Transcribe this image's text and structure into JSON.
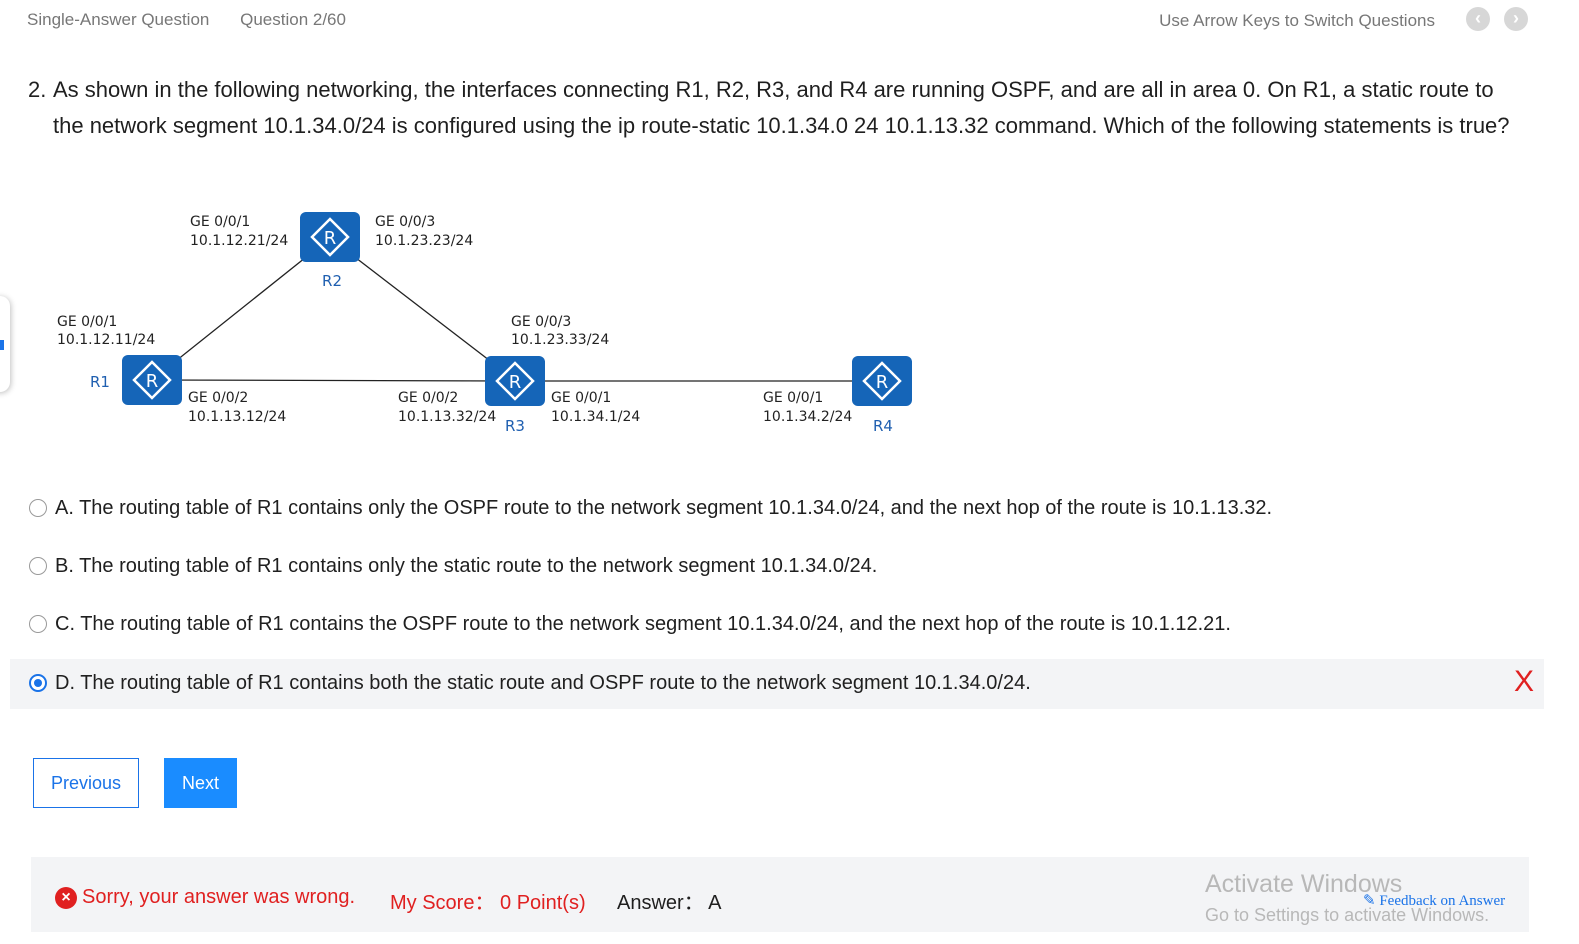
{
  "topbar": {
    "question_type": "Single-Answer Question",
    "question_counter": "Question 2/60",
    "hint": "Use Arrow Keys to Switch Questions",
    "prev_icon": "chevron-left-icon",
    "next_icon": "chevron-right-icon"
  },
  "question": {
    "number": "2.",
    "text": "As shown in the following networking, the interfaces connecting R1, R2, R3, and R4 are running OSPF, and are all in area 0. On R1, a static route to the network segment 10.1.34.0/24 is configured using the ip route-static 10.1.34.0 24 10.1.13.32 command. Which of the following statements is true?"
  },
  "diagram": {
    "routers": {
      "r1": "R1",
      "r2": "R2",
      "r3": "R3",
      "r4": "R4"
    },
    "labels": {
      "r2_left_if": "GE 0/0/1",
      "r2_left_ip": "10.1.12.21/24",
      "r2_right_if": "GE 0/0/3",
      "r2_right_ip": "10.1.23.23/24",
      "r1_top_if": "GE 0/0/1",
      "r1_top_ip": "10.1.12.11/24",
      "r1_right_if": "GE 0/0/2",
      "r1_right_ip": "10.1.13.12/24",
      "r3_top_if": "GE 0/0/3",
      "r3_top_ip": "10.1.23.33/24",
      "r3_left_if": "GE 0/0/2",
      "r3_left_ip": "10.1.13.32/24",
      "r3_right_if": "GE 0/0/1",
      "r3_right_ip": "10.1.34.1/24",
      "r4_left_if": "GE 0/0/1",
      "r4_left_ip": "10.1.34.2/24"
    },
    "router_color": "#1565b8"
  },
  "options": [
    {
      "text": "A. The routing table of R1 contains only the OSPF route to the network segment 10.1.34.0/24, and the next hop of the route is 10.1.13.32.",
      "selected": false
    },
    {
      "text": "B. The routing table of R1 contains only the static route to the network segment 10.1.34.0/24.",
      "selected": false
    },
    {
      "text": "C. The routing table of R1 contains the OSPF route to the network segment 10.1.34.0/24, and the next hop of the route is 10.1.12.21.",
      "selected": false
    },
    {
      "text": "D. The routing table of R1 contains both the static route and OSPF route to the network segment 10.1.34.0/24.",
      "selected": true,
      "mark": "X"
    }
  ],
  "buttons": {
    "previous": "Previous",
    "next": "Next"
  },
  "result": {
    "status_icon": "x-circle-icon",
    "wrong_text": "Sorry, your answer was wrong.",
    "score_text": "My Score： 0 Point(s)",
    "answer_text": "Answer： A",
    "feedback_text": "Feedback on Answer"
  },
  "watermark": {
    "line1": "Activate Windows",
    "line2": "Go to Settings to activate Windows."
  },
  "colors": {
    "accent": "#1a73e8",
    "error": "#e02020"
  }
}
